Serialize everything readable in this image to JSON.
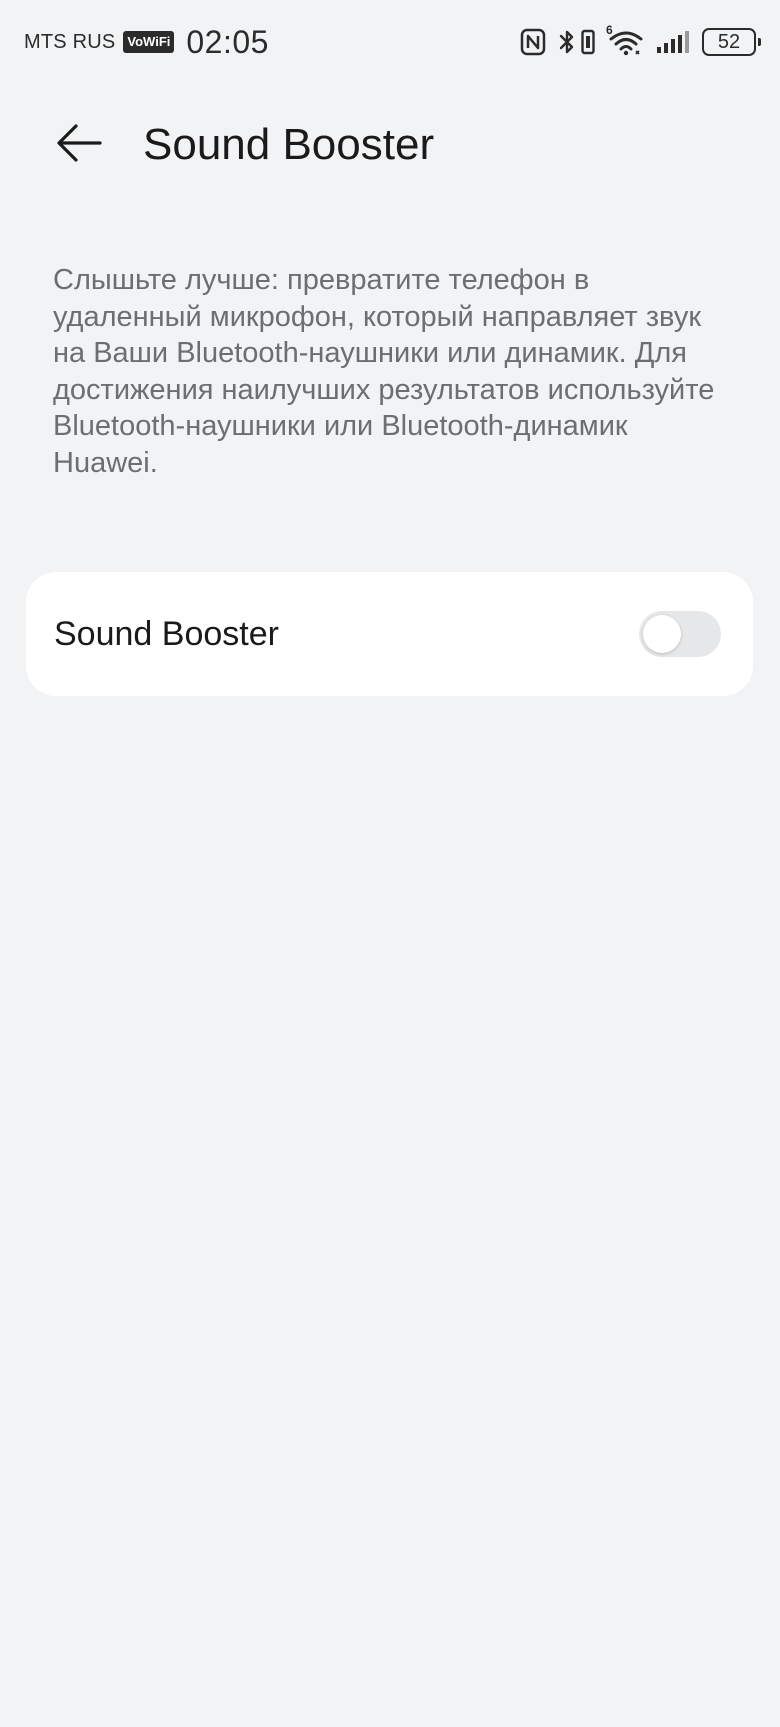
{
  "status_bar": {
    "carrier": "MTS RUS",
    "vowifi_badge": "VoWiFi",
    "time": "02:05",
    "wifi_badge": "6",
    "battery_level": "52",
    "icons": [
      "nfc-icon",
      "bluetooth-icon",
      "vibrate-icon",
      "wifi-icon",
      "signal-icon",
      "battery-icon"
    ]
  },
  "header": {
    "title": "Sound Booster",
    "back_icon": "back-arrow-icon"
  },
  "description": {
    "text": "Слышьте лучше: превратите телефон в удаленный микрофон, который направляет звук на Ваши Bluetooth-наушники или динамик. Для достижения наилучших результатов используйте Bluetooth-наушники или Bluetooth-динамик Huawei."
  },
  "settings": {
    "sound_booster": {
      "label": "Sound Booster",
      "enabled": false
    }
  },
  "colors": {
    "background": "#f1f3f5",
    "card": "#ffffff",
    "toggle_off": "#e6e7e9",
    "secondary_text": "#6b6e73"
  }
}
